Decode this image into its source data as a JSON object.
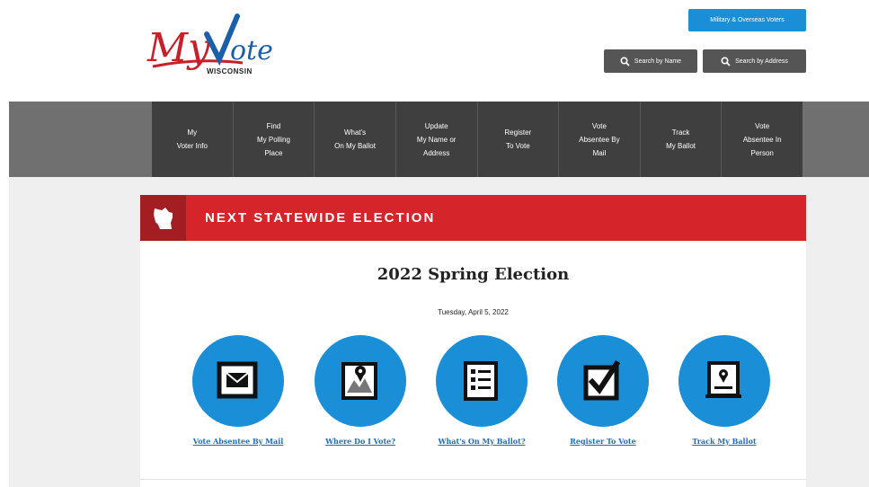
{
  "header": {
    "logo_text": "MyVote",
    "logo_subtitle": "WISCONSIN",
    "military_button": "Military & Overseas Voters",
    "search_by_name": "Search by Name",
    "search_by_address": "Search by Address",
    "search_icon": "search-icon"
  },
  "nav": {
    "items": [
      {
        "label": "My\nVoter Info"
      },
      {
        "label": "Find\nMy Polling\nPlace"
      },
      {
        "label": "What's\nOn My Ballot"
      },
      {
        "label": "Update\nMy Name or\nAddress"
      },
      {
        "label": "Register\nTo Vote"
      },
      {
        "label": "Vote\nAbsentee By\nMail"
      },
      {
        "label": "Track\nMy Ballot"
      },
      {
        "label": "Vote\nAbsentee In\nPerson"
      }
    ]
  },
  "banner": {
    "title": "NEXT STATEWIDE ELECTION",
    "icon": "wisconsin-state-icon"
  },
  "election": {
    "name": "2022 Spring Election",
    "date": "Tuesday, April 5, 2022"
  },
  "actions": [
    {
      "label": "Vote Absentee By Mail",
      "icon": "envelope-icon"
    },
    {
      "label": "Where Do I Vote?",
      "icon": "map-pin-icon"
    },
    {
      "label": "What's On My Ballot?",
      "icon": "ballot-list-icon"
    },
    {
      "label": "Register To Vote",
      "icon": "checkbox-icon"
    },
    {
      "label": "Track My Ballot",
      "icon": "track-ballot-icon"
    }
  ],
  "colors": {
    "accent_blue": "#1a8fd8",
    "banner_red": "#d6242b",
    "nav_dark": "#3f3f3f"
  }
}
